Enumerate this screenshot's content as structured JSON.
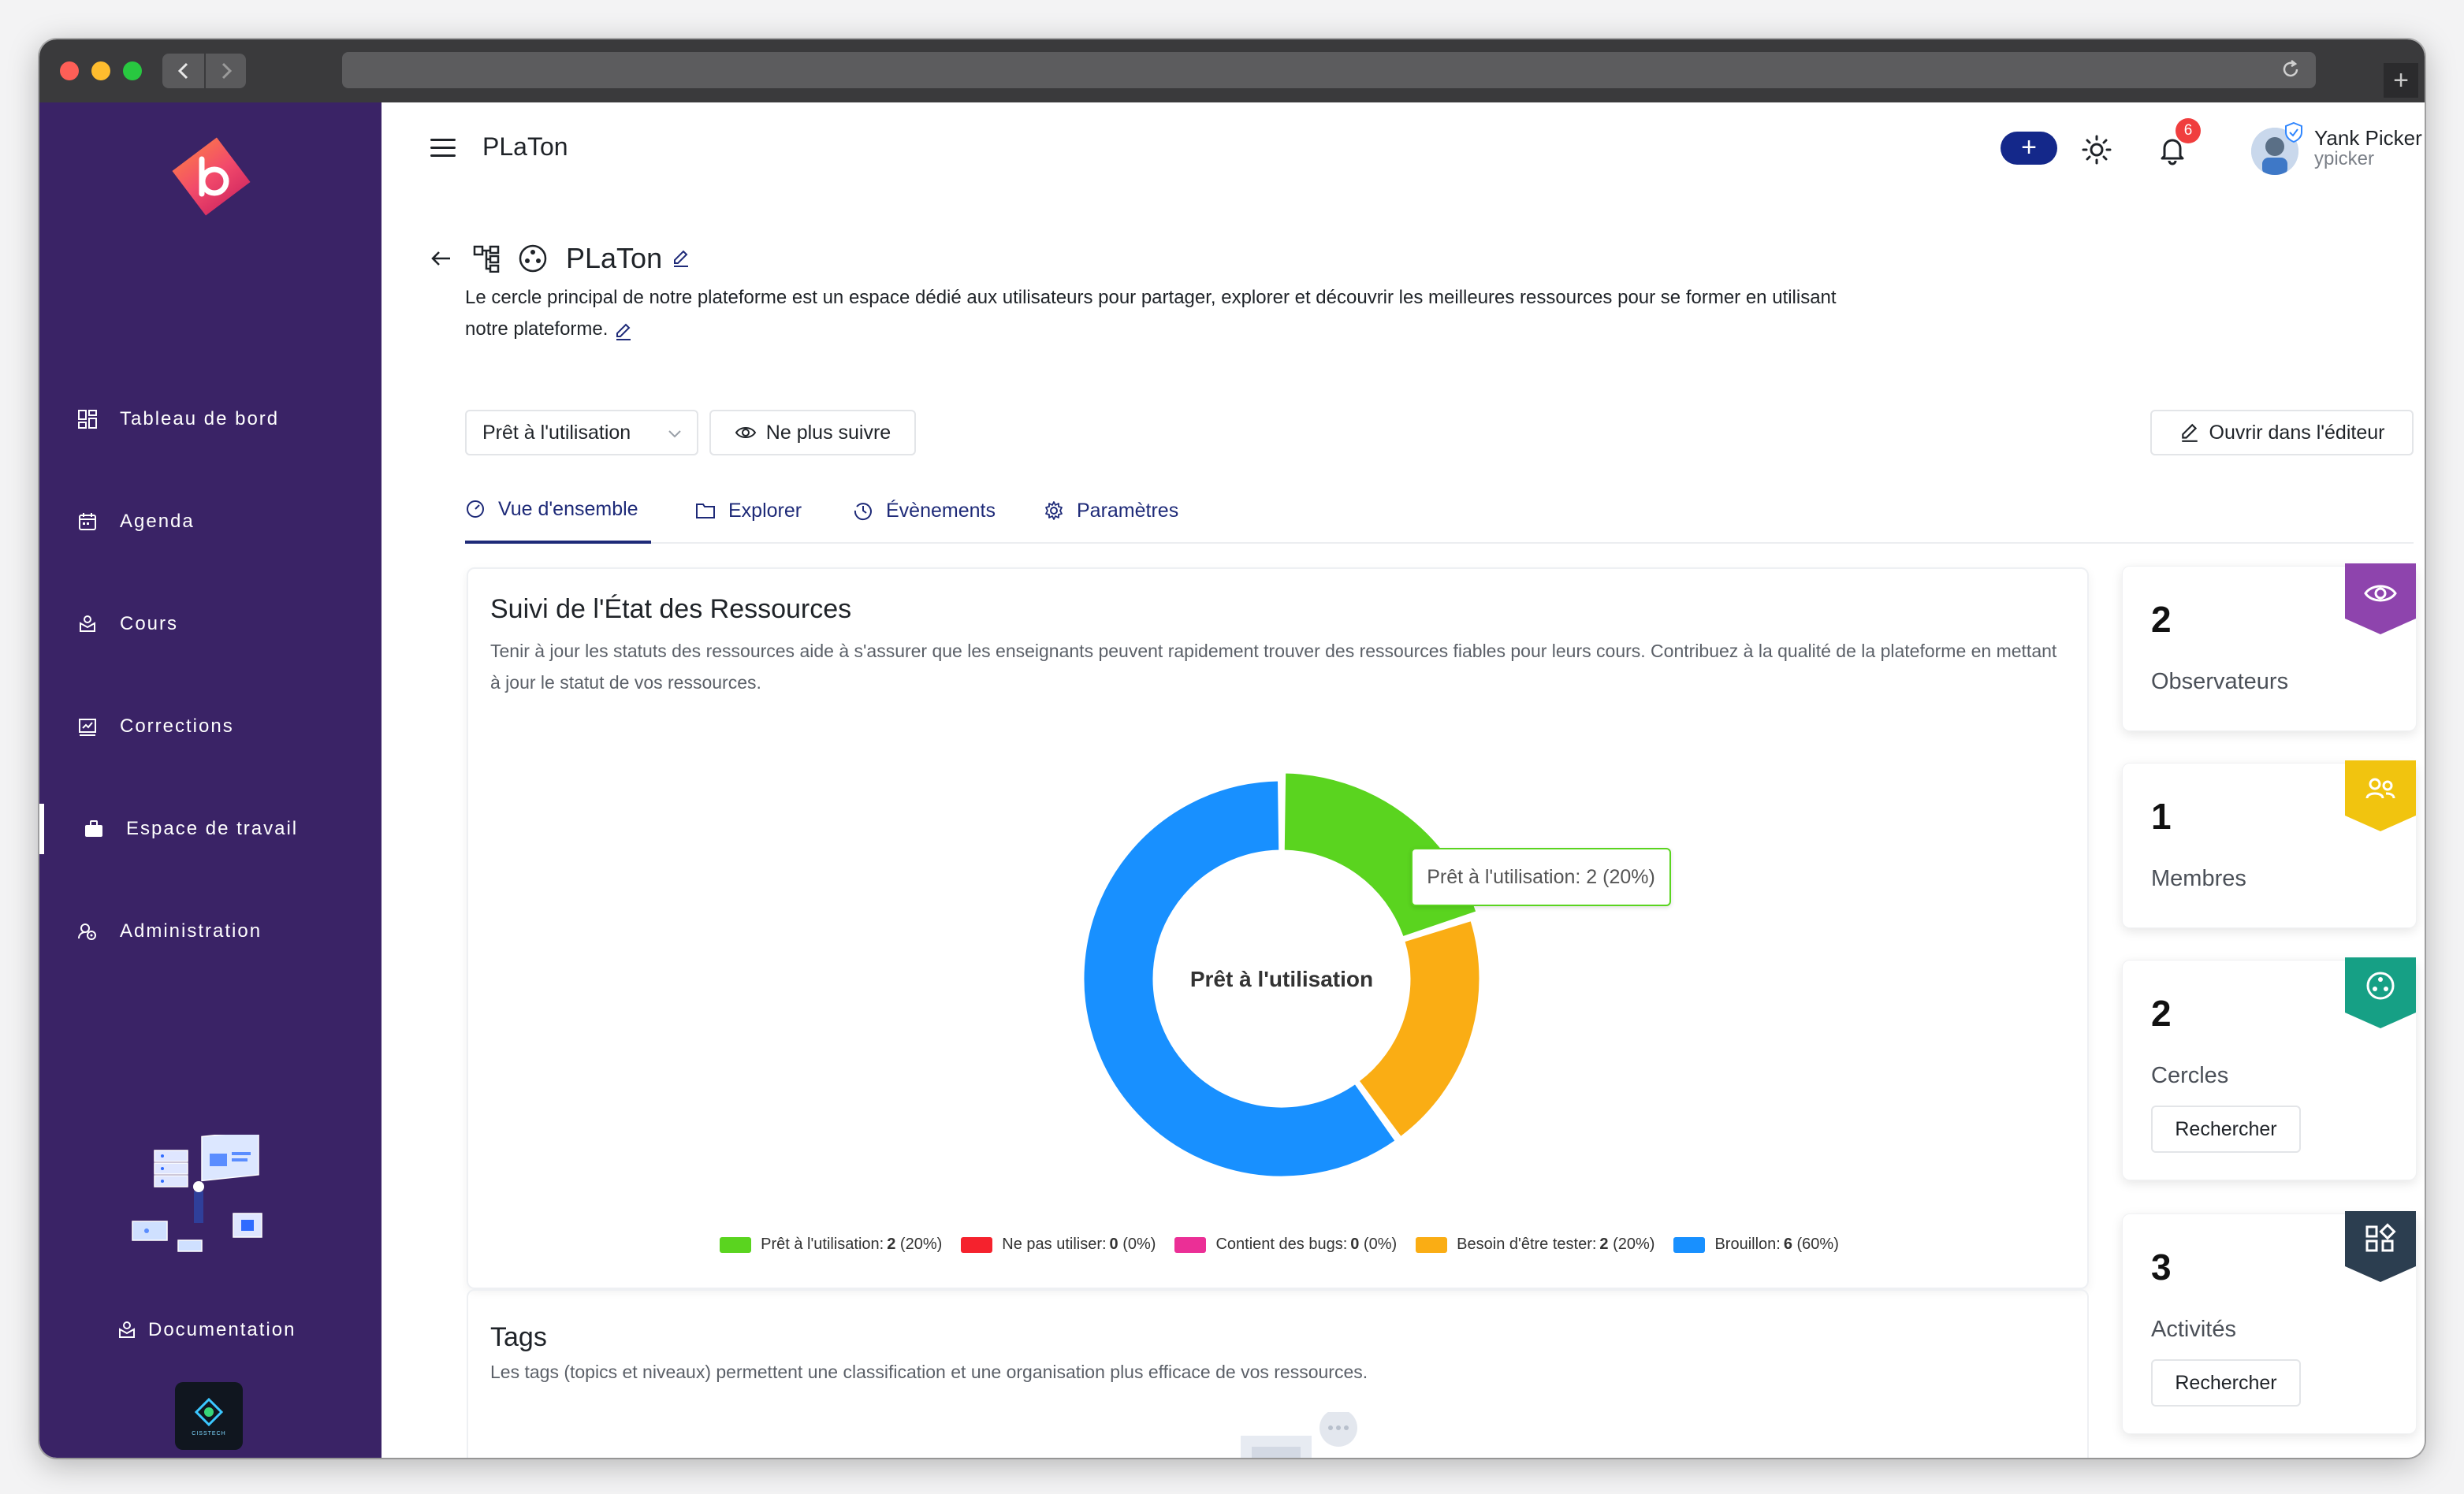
{
  "app": {
    "title": "PLaTon"
  },
  "sidebar": {
    "items": [
      {
        "label": "Tableau de bord",
        "icon": "dashboard-icon"
      },
      {
        "label": "Agenda",
        "icon": "calendar-icon"
      },
      {
        "label": "Cours",
        "icon": "course-icon"
      },
      {
        "label": "Corrections",
        "icon": "corrections-icon"
      },
      {
        "label": "Espace de travail",
        "icon": "briefcase-icon"
      },
      {
        "label": "Administration",
        "icon": "admin-icon"
      }
    ],
    "active_item": "Espace de travail",
    "documentation_label": "Documentation",
    "partner_label": "CISSTECH"
  },
  "header": {
    "notification_count": "6",
    "user_name": "Yank Picker",
    "user_handle": "ypicker"
  },
  "circle": {
    "name": "PLaTon",
    "description": "Le cercle principal de notre plateforme est un espace dédié aux utilisateurs pour partager, explorer et découvrir les meilleures ressources pour se former en utilisant notre plateforme."
  },
  "actions": {
    "status_value": "Prêt à l'utilisation",
    "unfollow_label": "Ne plus suivre",
    "open_editor_label": "Ouvrir dans l'éditeur"
  },
  "tabs": [
    {
      "label": "Vue d'ensemble",
      "active": true
    },
    {
      "label": "Explorer"
    },
    {
      "label": "Évènements"
    },
    {
      "label": "Paramètres"
    }
  ],
  "resources_card": {
    "title": "Suivi de l'État des Ressources",
    "description": "Tenir à jour les statuts des ressources aide à s'assurer que les enseignants peuvent rapidement trouver des ressources fiables pour leurs cours. Contribuez à la qualité de la plateforme en mettant à jour le statut de vos ressources.",
    "center_label": "Prêt à l'utilisation",
    "tooltip": "Prêt à l'utilisation: 2 (20%)"
  },
  "chart_data": {
    "type": "pie",
    "donut": true,
    "series": [
      {
        "name": "Prêt à l'utilisation",
        "value": 2,
        "percent": "20%",
        "color": "#5ad41f",
        "legend_count": "2",
        "legend_pct": "(20%)"
      },
      {
        "name": "Ne pas utiliser",
        "value": 0,
        "percent": "0%",
        "color": "#f5222d",
        "legend_count": "0",
        "legend_pct": "(0%)"
      },
      {
        "name": "Contient des bugs",
        "value": 0,
        "percent": "0%",
        "color": "#eb2f96",
        "legend_count": "0",
        "legend_pct": "(0%)"
      },
      {
        "name": "Besoin d'être tester",
        "value": 2,
        "percent": "20%",
        "color": "#faad14",
        "legend_count": "2",
        "legend_pct": "(20%)"
      },
      {
        "name": "Brouillon",
        "value": 6,
        "percent": "60%",
        "color": "#1890ff",
        "legend_count": "6",
        "legend_pct": "(60%)"
      }
    ],
    "highlighted": "Prêt à l'utilisation",
    "legend_position": "bottom"
  },
  "tags_card": {
    "title": "Tags",
    "description": "Les tags (topics et niveaux) permettent une classification et une organisation plus efficace de vos ressources."
  },
  "stats": [
    {
      "value": "2",
      "label": "Observateurs",
      "color": "#8e44ad",
      "icon": "eye-icon"
    },
    {
      "value": "1",
      "label": "Membres",
      "color": "#f1c40f",
      "icon": "members-icon"
    },
    {
      "value": "2",
      "label": "Cercles",
      "color": "#16a085",
      "icon": "circles-icon",
      "button": "Rechercher"
    },
    {
      "value": "3",
      "label": "Activités",
      "color": "#2c3e50",
      "icon": "activities-icon",
      "button": "Rechercher"
    }
  ],
  "stats_next_color": "#c0392b"
}
